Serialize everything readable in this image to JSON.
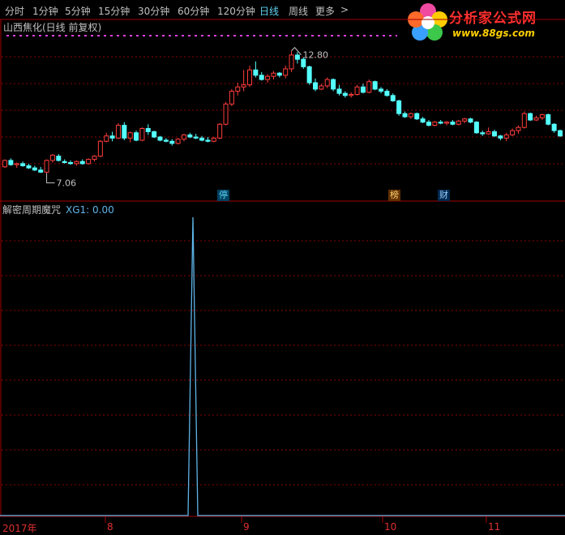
{
  "toolbar": {
    "items": [
      "分时",
      "1分钟",
      "5分钟",
      "15分钟",
      "30分钟",
      "60分钟",
      "120分钟",
      "日线",
      "周线",
      "更多"
    ],
    "active_index": 7,
    "more_arrow": ">"
  },
  "logo": {
    "title": "分析家公式网",
    "url": "www.88gs.com"
  },
  "stock_title": "山西焦化(日线 前复权)",
  "indicator": {
    "name": "解密周期魔咒",
    "value_label": "XG1: 0.00"
  },
  "price_labels": {
    "high": "12.80",
    "low": "7.06"
  },
  "markers": {
    "stop": "停",
    "rank": "榜",
    "finance": "财"
  },
  "x_axis_labels": [
    "2017年",
    "8",
    "9",
    "10",
    "11"
  ],
  "colors": {
    "up": "#ff3c3c",
    "down": "#54ffff",
    "grid": "#8b0000",
    "indicator_line": "#5fb4e8",
    "active_tab": "#5fd3f3"
  },
  "chart_data": [
    {
      "type": "candlestick",
      "title": "山西焦化(日线 前复权)",
      "annotations": [
        {
          "label": "12.80",
          "meaning": "period high"
        },
        {
          "label": "7.06",
          "meaning": "period low"
        }
      ],
      "x_tick_labels": [
        "2017年",
        "8",
        "9",
        "10",
        "11"
      ],
      "candles": [
        [
          7.35,
          7.7,
          7.3,
          7.65
        ],
        [
          7.65,
          7.75,
          7.4,
          7.45
        ],
        [
          7.45,
          7.55,
          7.3,
          7.5
        ],
        [
          7.5,
          7.6,
          7.35,
          7.4
        ],
        [
          7.4,
          7.5,
          7.25,
          7.3
        ],
        [
          7.3,
          7.4,
          7.15,
          7.2
        ],
        [
          7.2,
          7.35,
          7.06,
          7.1
        ],
        [
          7.1,
          7.7,
          7.05,
          7.65
        ],
        [
          7.65,
          7.95,
          7.55,
          7.9
        ],
        [
          7.85,
          7.95,
          7.6,
          7.65
        ],
        [
          7.6,
          7.7,
          7.5,
          7.55
        ],
        [
          7.55,
          7.65,
          7.45,
          7.5
        ],
        [
          7.5,
          7.65,
          7.4,
          7.6
        ],
        [
          7.6,
          7.7,
          7.45,
          7.5
        ],
        [
          7.5,
          7.75,
          7.45,
          7.7
        ],
        [
          7.7,
          7.9,
          7.6,
          7.85
        ],
        [
          7.85,
          8.6,
          7.8,
          8.55
        ],
        [
          8.55,
          8.95,
          8.5,
          8.8
        ],
        [
          8.8,
          9.0,
          8.55,
          8.7
        ],
        [
          8.7,
          9.4,
          8.65,
          9.3
        ],
        [
          9.3,
          9.45,
          8.6,
          8.7
        ],
        [
          8.7,
          9.0,
          8.5,
          8.95
        ],
        [
          8.95,
          9.05,
          8.55,
          8.6
        ],
        [
          8.6,
          9.2,
          8.55,
          9.15
        ],
        [
          9.15,
          9.35,
          8.85,
          9.0
        ],
        [
          9.0,
          9.05,
          8.7,
          8.75
        ],
        [
          8.75,
          8.8,
          8.55,
          8.6
        ],
        [
          8.6,
          8.7,
          8.5,
          8.55
        ],
        [
          8.55,
          8.65,
          8.35,
          8.45
        ],
        [
          8.45,
          8.7,
          8.4,
          8.65
        ],
        [
          8.65,
          8.9,
          8.55,
          8.85
        ],
        [
          8.85,
          8.95,
          8.7,
          8.75
        ],
        [
          8.75,
          8.9,
          8.65,
          8.7
        ],
        [
          8.7,
          8.8,
          8.55,
          8.6
        ],
        [
          8.6,
          8.75,
          8.5,
          8.55
        ],
        [
          8.55,
          8.75,
          8.5,
          8.7
        ],
        [
          8.7,
          9.4,
          8.65,
          9.35
        ],
        [
          9.35,
          10.4,
          9.3,
          10.3
        ],
        [
          10.3,
          11.0,
          10.2,
          10.9
        ],
        [
          10.9,
          11.3,
          10.7,
          11.1
        ],
        [
          11.1,
          11.9,
          10.9,
          11.2
        ],
        [
          11.2,
          12.1,
          11.1,
          11.9
        ],
        [
          11.9,
          12.3,
          11.55,
          11.65
        ],
        [
          11.65,
          11.8,
          11.4,
          11.45
        ],
        [
          11.45,
          11.7,
          11.3,
          11.6
        ],
        [
          11.6,
          11.85,
          11.45,
          11.75
        ],
        [
          11.75,
          11.8,
          11.55,
          11.65
        ],
        [
          11.65,
          12.1,
          11.5,
          11.95
        ],
        [
          11.95,
          12.8,
          11.8,
          12.6
        ],
        [
          12.6,
          12.75,
          12.2,
          12.4
        ],
        [
          12.4,
          12.5,
          11.95,
          12.05
        ],
        [
          12.05,
          12.1,
          11.2,
          11.3
        ],
        [
          11.3,
          11.5,
          10.9,
          11.0
        ],
        [
          11.0,
          11.25,
          10.95,
          11.15
        ],
        [
          11.15,
          11.55,
          11.05,
          11.45
        ],
        [
          11.45,
          11.5,
          10.9,
          11.0
        ],
        [
          11.0,
          11.2,
          10.7,
          10.8
        ],
        [
          10.8,
          10.9,
          10.6,
          10.7
        ],
        [
          10.7,
          10.85,
          10.6,
          10.75
        ],
        [
          10.75,
          11.2,
          10.7,
          11.1
        ],
        [
          11.1,
          11.25,
          10.8,
          10.85
        ],
        [
          10.85,
          11.45,
          10.8,
          11.35
        ],
        [
          11.35,
          11.4,
          10.95,
          11.0
        ],
        [
          11.0,
          11.1,
          10.8,
          10.9
        ],
        [
          10.9,
          11.0,
          10.65,
          10.7
        ],
        [
          10.7,
          10.8,
          10.4,
          10.45
        ],
        [
          10.45,
          10.5,
          9.75,
          9.85
        ],
        [
          9.85,
          9.95,
          9.65,
          9.7
        ],
        [
          9.7,
          9.9,
          9.6,
          9.85
        ],
        [
          9.85,
          9.9,
          9.55,
          9.6
        ],
        [
          9.6,
          9.7,
          9.4,
          9.45
        ],
        [
          9.45,
          9.55,
          9.25,
          9.3
        ],
        [
          9.3,
          9.5,
          9.25,
          9.45
        ],
        [
          9.45,
          9.55,
          9.35,
          9.4
        ],
        [
          9.4,
          9.5,
          9.3,
          9.45
        ],
        [
          9.45,
          9.55,
          9.3,
          9.35
        ],
        [
          9.35,
          9.55,
          9.3,
          9.5
        ],
        [
          9.5,
          9.65,
          9.4,
          9.6
        ],
        [
          9.6,
          9.65,
          9.4,
          9.45
        ],
        [
          9.45,
          9.5,
          8.9,
          8.95
        ],
        [
          8.95,
          9.05,
          8.8,
          8.9
        ],
        [
          8.9,
          9.2,
          8.85,
          9.0
        ],
        [
          9.0,
          9.1,
          8.75,
          8.8
        ],
        [
          8.8,
          8.85,
          8.6,
          8.7
        ],
        [
          8.7,
          8.95,
          8.55,
          8.85
        ],
        [
          8.85,
          9.15,
          8.8,
          9.05
        ],
        [
          9.05,
          9.3,
          8.9,
          9.2
        ],
        [
          9.2,
          9.95,
          9.15,
          9.85
        ],
        [
          9.85,
          9.9,
          9.5,
          9.55
        ],
        [
          9.55,
          9.75,
          9.5,
          9.65
        ],
        [
          9.65,
          9.85,
          9.55,
          9.8
        ],
        [
          9.8,
          9.85,
          9.3,
          9.35
        ],
        [
          9.35,
          9.4,
          8.95,
          9.05
        ],
        [
          9.05,
          9.1,
          8.75,
          8.8
        ]
      ]
    },
    {
      "type": "line",
      "title": "解密周期魔咒",
      "series": [
        {
          "name": "XG1",
          "values": [
            [
              0,
              0
            ],
            [
              232,
              0
            ],
            [
              238,
              1
            ],
            [
              244,
              0
            ],
            [
              697,
              0
            ]
          ]
        }
      ]
    }
  ]
}
